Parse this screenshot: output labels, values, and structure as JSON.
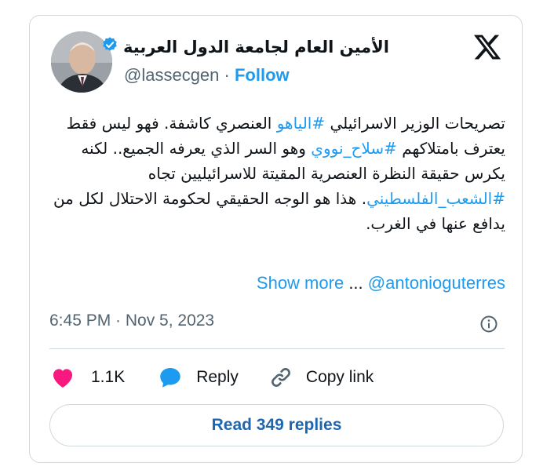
{
  "author": {
    "display_name": "الأمين العام لجامعة الدول العربية",
    "handle": "@lassecgen",
    "separator": "·",
    "follow_label": "Follow"
  },
  "tweet": {
    "line1_a": "تصريحات الوزير الاسرائيلي ",
    "hashtag1": "#الياهو",
    "line1_b": " العنصري كاشفة. فهو ليس فقط يعترف بامتلاكهم ",
    "hashtag2": "#سلاح_نووي",
    "line2_b": " وهو السر الذي يعرفه الجميع.. لكنه يكرس حقيقة النظرة العنصرية المقيتة للاسرائيليين تجاه ",
    "hashtag3": "#الشعب_الفلسطيني",
    "line3_b": ". هذا هو الوجه الحقيقي لحكومة الاحتلال لكل من يدافع عنها في الغرب."
  },
  "mention": "@antonioguterres",
  "show_more_label": "Show more",
  "ellipsis": "...",
  "timestamp": "6:45 PM · Nov 5, 2023",
  "actions": {
    "likes": "1.1K",
    "reply_label": "Reply",
    "copy_link_label": "Copy link"
  },
  "read_replies_label": "Read 349 replies",
  "colors": {
    "accent": "#1d9bf0",
    "like": "#f91880",
    "text": "#0f1419",
    "muted": "#536471",
    "border": "#cfd9de"
  },
  "icons": [
    "verified-badge-icon",
    "x-logo-icon",
    "info-icon",
    "heart-icon",
    "reply-bubble-icon",
    "link-icon"
  ]
}
